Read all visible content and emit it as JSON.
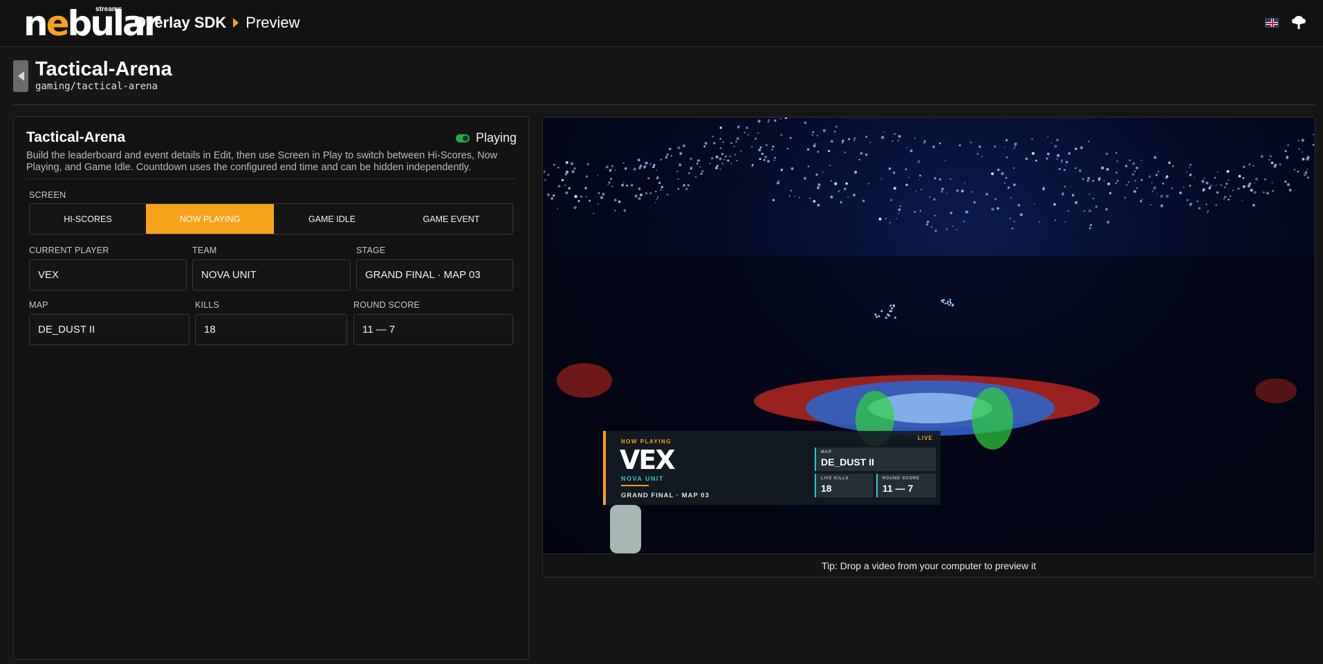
{
  "app": {
    "logo_text": "nebular",
    "logo_sub": "streams",
    "breadcrumb": [
      "Overlay SDK",
      "Preview"
    ]
  },
  "header": {
    "language_icon": "uk-flag-icon",
    "upload_icon": "cloud-upload-icon"
  },
  "page": {
    "title": "Tactical-Arena",
    "slug": "gaming/tactical-arena",
    "back_icon": "chevron-left-icon"
  },
  "panel": {
    "title": "Tactical-Arena",
    "status": "Playing",
    "description": "Build the leaderboard and event details in Edit, then use Screen in Play to switch between Hi-Scores, Now Playing, and Game Idle. Countdown uses the configured end time and can be hidden independently.",
    "screen_label": "SCREEN",
    "screen_options": [
      "HI-SCORES",
      "NOW PLAYING",
      "GAME IDLE",
      "GAME EVENT"
    ],
    "screen_selected": "NOW PLAYING",
    "fields": {
      "current_player": {
        "label": "CURRENT PLAYER",
        "value": "VEX"
      },
      "team": {
        "label": "TEAM",
        "value": "NOVA UNIT"
      },
      "stage": {
        "label": "STAGE",
        "value": "GRAND FINAL · MAP 03"
      },
      "map": {
        "label": "MAP",
        "value": "DE_DUST II"
      },
      "kills": {
        "label": "KILLS",
        "value": "18"
      },
      "round_score": {
        "label": "ROUND SCORE",
        "value": "11 — 7"
      }
    }
  },
  "preview": {
    "tip": "Tip: Drop a video from your computer to preview it",
    "overlay": {
      "now_playing": "NOW PLAYING",
      "player": "VEX",
      "team": "NOVA UNIT",
      "stage": "GRAND FINAL · MAP 03",
      "live": "LIVE",
      "map_label": "MAP",
      "map_value": "DE_DUST II",
      "kills_label": "LIVE KILLS",
      "kills_value": "18",
      "score_label": "ROUND SCORE",
      "score_value": "11 — 7"
    }
  },
  "colors": {
    "accent": "#f7a21b",
    "team_cyan": "#35c6d3",
    "status_green": "#27a844"
  }
}
